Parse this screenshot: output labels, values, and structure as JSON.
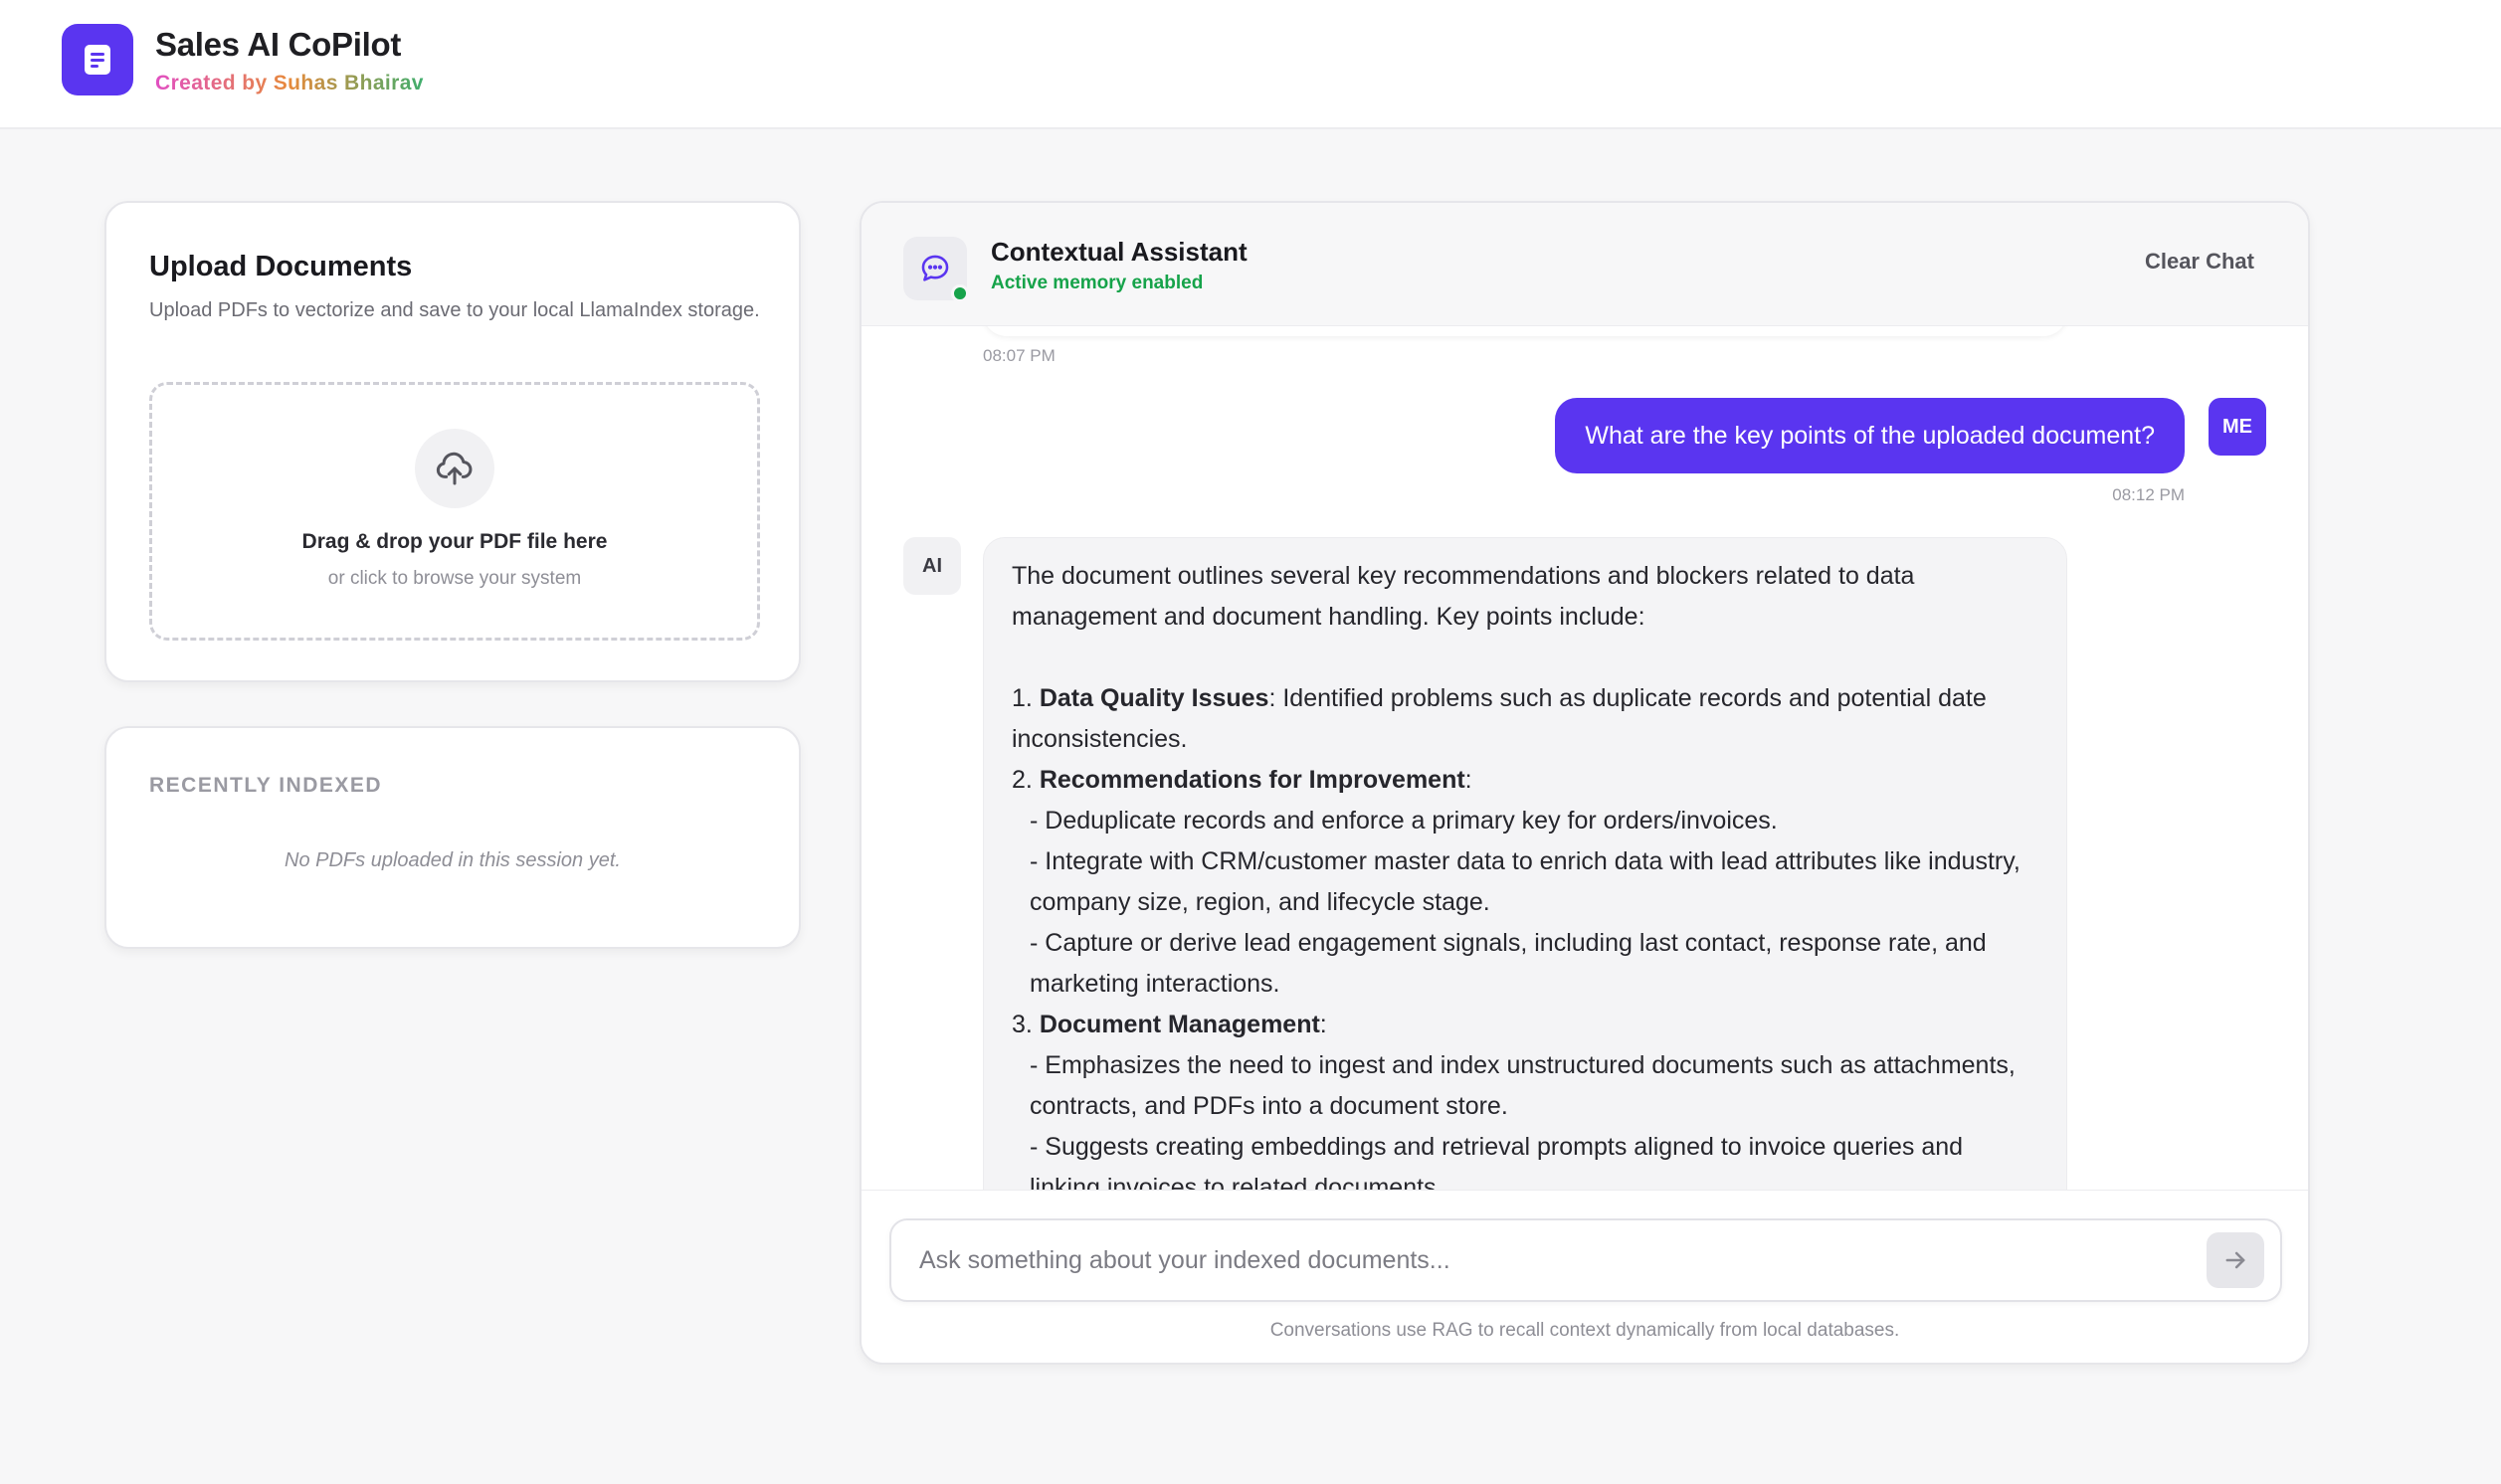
{
  "header": {
    "app_title": "Sales AI CoPilot",
    "credit": "Created by Suhas Bhairav",
    "logo_icon": "document-icon",
    "brand_color": "#5a35f0"
  },
  "upload": {
    "title": "Upload Documents",
    "description": "Upload PDFs to vectorize and save to your local LlamaIndex storage.",
    "drop_main": "Drag & drop your PDF file here",
    "drop_sub": "or click to browse your system",
    "icon": "cloud-upload-icon"
  },
  "recent": {
    "title": "RECENTLY INDEXED",
    "empty_text": "No PDFs uploaded in this session yet."
  },
  "chat": {
    "assistant_name": "Contextual Assistant",
    "assistant_status": "Active memory enabled",
    "clear_label": "Clear Chat",
    "status_color": "#16a34a",
    "messages": [
      {
        "role": "ai",
        "time": "08:07 PM"
      },
      {
        "role": "user",
        "avatar": "ME",
        "text": "What are the key points of the uploaded document?",
        "time": "08:12 PM"
      },
      {
        "role": "ai",
        "avatar": "AI",
        "intro": "The document outlines several key recommendations and blockers related to data management and document handling. Key points include:",
        "points": [
          {
            "num": "1.",
            "heading": "Data Quality Issues",
            "text": ": Identified problems such as duplicate records and potential date inconsistencies."
          },
          {
            "num": "2.",
            "heading": "Recommendations for Improvement",
            "text": ":",
            "bullets": [
              "- Deduplicate records and enforce a primary key for orders/invoices.",
              "- Integrate with CRM/customer master data to enrich data with lead attributes like industry, company size, region, and lifecycle stage.",
              "- Capture or derive lead engagement signals, including last contact, response rate, and marketing interactions."
            ]
          },
          {
            "num": "3.",
            "heading": "Document Management",
            "text": ":",
            "bullets": [
              "- Emphasizes the need to ingest and index unstructured documents such as attachments, contracts, and PDFs into a document store.",
              "- Suggests creating embeddings and retrieval prompts aligned to invoice queries and linking invoices to related documents."
            ]
          }
        ]
      }
    ],
    "input_placeholder": "Ask something about your indexed documents...",
    "send_icon": "arrow-right-icon",
    "footnote": "Conversations use RAG to recall context dynamically from local databases."
  }
}
